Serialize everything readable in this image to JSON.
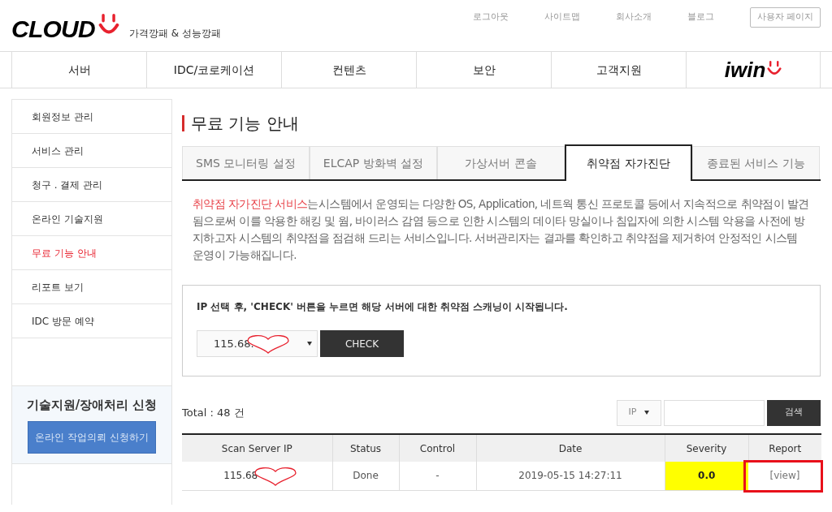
{
  "logo": {
    "wordmark": "CLOUD",
    "tagline": "가격깡패 & 성능깡패"
  },
  "top_links": [
    "로그아웃",
    "사이트맵",
    "회사소개",
    "블로그"
  ],
  "user_page_button": "사용자 페이지",
  "nav": {
    "items": [
      "서버",
      "IDC/코로케이션",
      "컨텐츠",
      "보안",
      "고객지원"
    ],
    "partner_logo": "iwin"
  },
  "sidebar": {
    "items": [
      {
        "label": "회원정보 관리",
        "selected": false
      },
      {
        "label": "서비스 관리",
        "selected": false
      },
      {
        "label": "청구 . 결제 관리",
        "selected": false
      },
      {
        "label": "온라인 기술지원",
        "selected": false
      },
      {
        "label": "무료 기능 안내",
        "selected": true
      },
      {
        "label": "리포트 보기",
        "selected": false
      },
      {
        "label": "IDC 방문 예약",
        "selected": false
      }
    ],
    "support_box": {
      "title": "기술지원/장애처리 신청",
      "button": "온라인 작업의뢰 신청하기"
    }
  },
  "page_title": "무료 기능 안내",
  "tabs": [
    {
      "label": "SMS 모니터링 설정",
      "selected": false
    },
    {
      "label": "ELCAP 방화벽 설정",
      "selected": false
    },
    {
      "label": "가상서버 콘솔",
      "selected": false
    },
    {
      "label": "취약점 자가진단",
      "selected": true
    },
    {
      "label": "종료된 서비스 기능",
      "selected": false
    }
  ],
  "description": {
    "highlight": "취약점 자가진단 서비스",
    "text": "는시스템에서 운영되는 다양한 OS, Application, 네트웍 통신 프로토콜 등에서 지속적으로 취약점이 발견됨으로써 이를 악용한 해킹 및 웜, 바이러스 감염 등으로 인한 시스템의 데이타 망실이나 침입자에 의한 시스템 악용을 사전에 방지하고자 시스템의 취약점을 점검해 드리는 서비스입니다. 서버관리자는 결과를 확인하고 취약점을 제거하여 안정적인 시스템 운영이 가능해집니다."
  },
  "check_panel": {
    "instruction": "IP 선택 후, 'CHECK' 버튼을 누르면 해당 서버에 대한 취약점 스캐닝이 시작됩니다.",
    "ip_select": "115.68.",
    "button": "CHECK"
  },
  "total": {
    "label": "Total :",
    "count": "48 건"
  },
  "search": {
    "field_select": "IP",
    "button": "검색"
  },
  "table": {
    "columns": [
      "Scan Server IP",
      "Status",
      "Control",
      "Date",
      "Severity",
      "Report"
    ],
    "rows": [
      {
        "ip": "115.68",
        "status": "Done",
        "control": "-",
        "date": "2019-05-15 14:27:11",
        "severity": "0.0",
        "color": "#ffff00",
        "report": "[view]"
      }
    ]
  }
}
